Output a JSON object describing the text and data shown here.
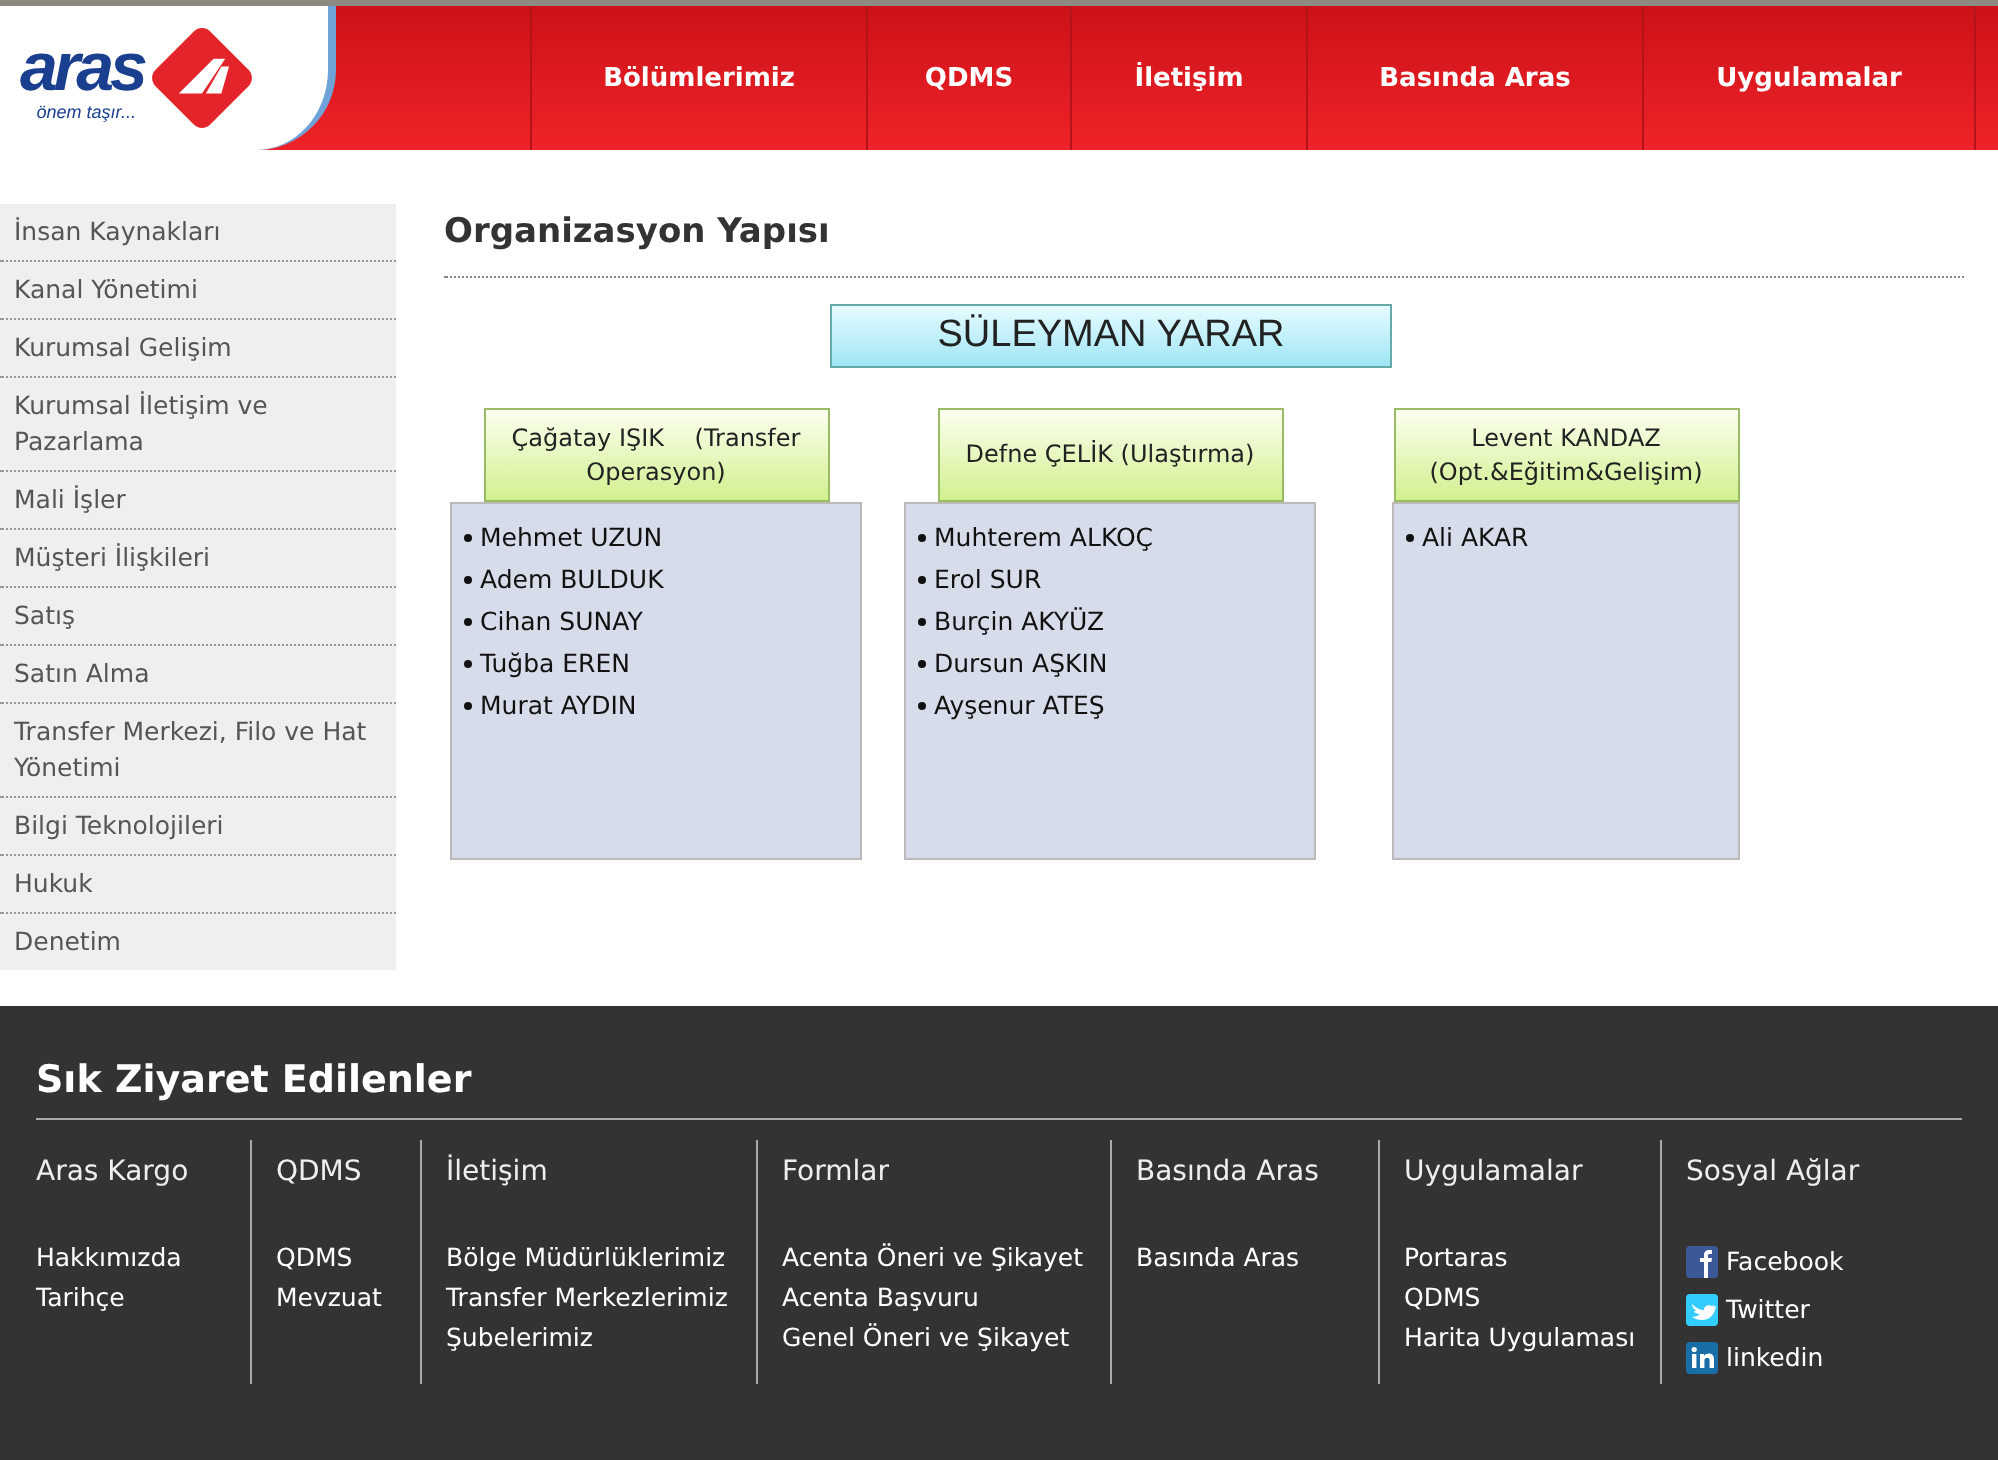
{
  "logo": {
    "name": "aras",
    "tagline": "önem taşır..."
  },
  "nav": [
    "Bölümlerimiz",
    "QDMS",
    "İletişim",
    "Basında Aras",
    "Uygulamalar"
  ],
  "sidebar": {
    "items": [
      "İnsan Kaynakları",
      "Kanal Yönetimi",
      "Kurumsal Gelişim",
      "Kurumsal İletişim ve Pazarlama",
      "Mali İşler",
      "Müşteri İlişkileri",
      "Satış",
      "Satın Alma",
      "Transfer Merkezi, Filo ve Hat Yönetimi",
      "Bilgi Teknolojileri",
      "Hukuk",
      "Denetim"
    ]
  },
  "page_title": "Organizasyon Yapısı",
  "org_chart": {
    "head": "SÜLEYMAN YARAR",
    "units": [
      {
        "lead": "Çağatay IŞIK    (Transfer Operasyon)",
        "members": [
          "Mehmet UZUN",
          "Adem BULDUK",
          "Cihan SUNAY",
          "Tuğba EREN",
          "Murat AYDIN"
        ]
      },
      {
        "lead": "Defne ÇELİK (Ulaştırma)",
        "members": [
          "Muhterem ALKOÇ",
          "Erol SUR",
          "Burçin AKYÜZ",
          "Dursun AŞKIN",
          "Ayşenur ATEŞ"
        ]
      },
      {
        "lead": "Levent KANDAZ (Opt.&Eğitim&Gelişim)",
        "members": [
          "Ali AKAR"
        ]
      }
    ]
  },
  "footer": {
    "title": "Sık Ziyaret Edilenler",
    "columns": [
      {
        "heading": "Aras Kargo",
        "links": [
          {
            "label": "Hakkımızda",
            "kind": "text"
          },
          {
            "label": "Tarihçe",
            "kind": "text"
          }
        ]
      },
      {
        "heading": "QDMS",
        "links": [
          {
            "label": "QDMS",
            "kind": "text"
          },
          {
            "label": "Mevzuat",
            "kind": "text"
          }
        ]
      },
      {
        "heading": "İletişim",
        "links": [
          {
            "label": "Bölge Müdürlüklerimiz",
            "kind": "text"
          },
          {
            "label": "Transfer Merkezlerimiz",
            "kind": "text"
          },
          {
            "label": "Şubelerimiz",
            "kind": "text"
          }
        ]
      },
      {
        "heading": "Formlar",
        "links": [
          {
            "label": "Acenta Öneri ve Şikayet",
            "kind": "text"
          },
          {
            "label": "Acenta Başvuru",
            "kind": "text"
          },
          {
            "label": "Genel Öneri ve Şikayet",
            "kind": "text"
          }
        ]
      },
      {
        "heading": "Basında Aras",
        "links": [
          {
            "label": "Basında Aras",
            "kind": "text"
          }
        ]
      },
      {
        "heading": "Uygulamalar",
        "links": [
          {
            "label": "Portaras",
            "kind": "text"
          },
          {
            "label": "QDMS",
            "kind": "text"
          },
          {
            "label": "Harita Uygulaması",
            "kind": "text"
          }
        ]
      },
      {
        "heading": "Sosyal Ağlar",
        "links": [
          {
            "label": "Facebook",
            "kind": "social"
          },
          {
            "label": "Twitter",
            "kind": "social"
          },
          {
            "label": "linkedin",
            "kind": "social"
          }
        ]
      }
    ]
  }
}
